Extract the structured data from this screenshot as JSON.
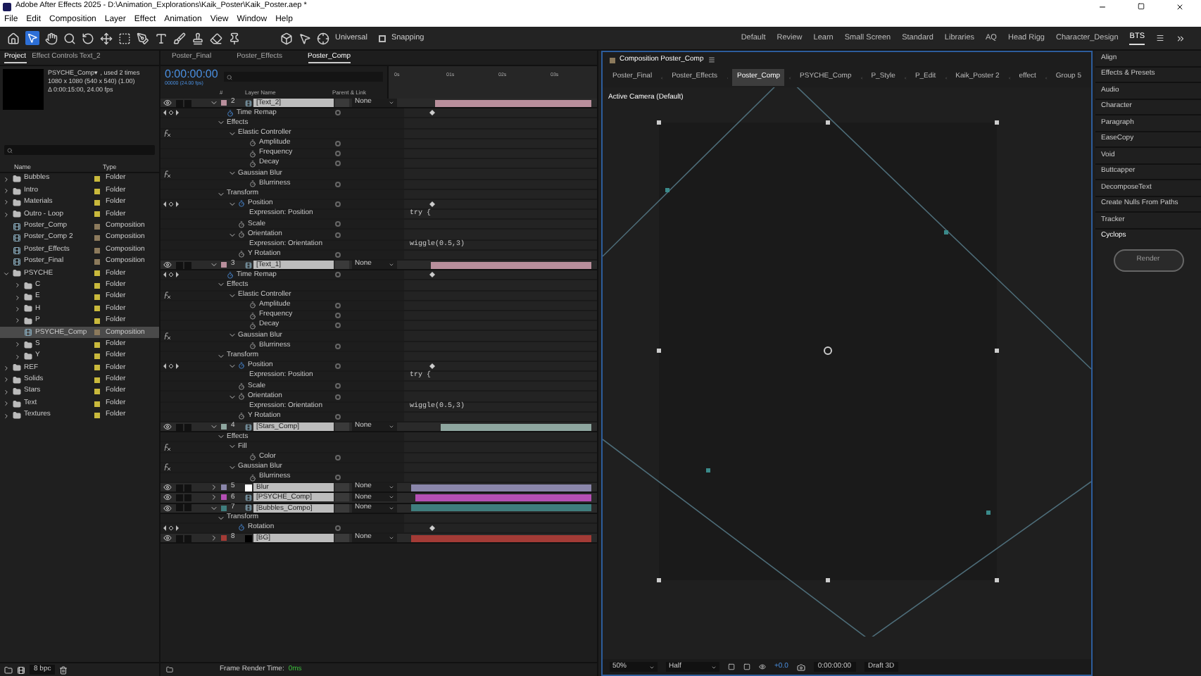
{
  "window": {
    "title": "Adobe After Effects 2025 - D:\\Animation_Explorations\\Kaik_Poster\\Kaik_Poster.aep *"
  },
  "menu": [
    "File",
    "Edit",
    "Composition",
    "Layer",
    "Effect",
    "Animation",
    "View",
    "Window",
    "Help"
  ],
  "toolbar": {
    "axis_mode": "Universal",
    "snapping": {
      "label": "Snapping",
      "checked": false
    }
  },
  "workspaces": [
    {
      "label": "Default",
      "selected": false
    },
    {
      "label": "Review",
      "selected": false
    },
    {
      "label": "Learn",
      "selected": false
    },
    {
      "label": "Small Screen",
      "selected": false
    },
    {
      "label": "Standard",
      "selected": false
    },
    {
      "label": "Libraries",
      "selected": false
    },
    {
      "label": "AQ",
      "selected": false
    },
    {
      "label": "Head Rigg",
      "selected": false
    },
    {
      "label": "Character_Design",
      "selected": false
    },
    {
      "label": "BTS",
      "selected": true
    }
  ],
  "project_panel": {
    "tabs": [
      {
        "label": "Project",
        "selected": true
      },
      {
        "label": "Effect Controls Text_2",
        "selected": false
      }
    ],
    "info": [
      "PSYCHE_Comp▾ , used 2 times",
      "1080 x 1080  (540 x 540) (1.00)",
      "Δ 0:00:15:00, 24.00 fps"
    ],
    "columns": [
      "Name",
      "Type"
    ],
    "items": [
      {
        "name": "Bubbles",
        "type": "Folder",
        "kind": "folder",
        "expanded": false,
        "selected": false,
        "color": "#c9b93c"
      },
      {
        "name": "Intro",
        "type": "Folder",
        "kind": "folder",
        "expanded": false,
        "selected": false,
        "color": "#c9b93c"
      },
      {
        "name": "Materials",
        "type": "Folder",
        "kind": "folder",
        "expanded": false,
        "selected": false,
        "color": "#c9b93c"
      },
      {
        "name": "Outro - Loop",
        "type": "Folder",
        "kind": "folder",
        "expanded": false,
        "selected": false,
        "color": "#c9b93c"
      },
      {
        "name": "Poster_Comp",
        "type": "Composition",
        "kind": "comp",
        "selected": false,
        "color": "#8c7a5c"
      },
      {
        "name": "Poster_Comp 2",
        "type": "Composition",
        "kind": "comp",
        "selected": false,
        "color": "#8c7a5c"
      },
      {
        "name": "Poster_Effects",
        "type": "Composition",
        "kind": "comp",
        "selected": false,
        "color": "#8c7a5c"
      },
      {
        "name": "Poster_Final",
        "type": "Composition",
        "kind": "comp",
        "selected": false,
        "color": "#8c7a5c"
      },
      {
        "name": "PSYCHE",
        "type": "Folder",
        "kind": "folder",
        "expanded": true,
        "selected": false,
        "color": "#c9b93c",
        "children": [
          {
            "name": "C",
            "type": "Folder",
            "kind": "folder",
            "expanded": false,
            "selected": false,
            "color": "#c9b93c"
          },
          {
            "name": "E",
            "type": "Folder",
            "kind": "folder",
            "expanded": false,
            "selected": false,
            "color": "#c9b93c"
          },
          {
            "name": "H",
            "type": "Folder",
            "kind": "folder",
            "expanded": false,
            "selected": false,
            "color": "#c9b93c"
          },
          {
            "name": "P",
            "type": "Folder",
            "kind": "folder",
            "expanded": false,
            "selected": false,
            "color": "#c9b93c"
          },
          {
            "name": "PSYCHE_Comp",
            "type": "Composition",
            "kind": "comp",
            "selected": true,
            "color": "#8c7a5c"
          },
          {
            "name": "S",
            "type": "Folder",
            "kind": "folder",
            "expanded": false,
            "selected": false,
            "color": "#c9b93c"
          },
          {
            "name": "Y",
            "type": "Folder",
            "kind": "folder",
            "expanded": false,
            "selected": false,
            "color": "#c9b93c"
          }
        ]
      },
      {
        "name": "REF",
        "type": "Folder",
        "kind": "folder",
        "expanded": false,
        "selected": false,
        "color": "#c9b93c"
      },
      {
        "name": "Solids",
        "type": "Folder",
        "kind": "folder",
        "expanded": false,
        "selected": false,
        "color": "#c9b93c"
      },
      {
        "name": "Stars",
        "type": "Folder",
        "kind": "folder",
        "expanded": false,
        "selected": false,
        "color": "#c9b93c"
      },
      {
        "name": "Text",
        "type": "Folder",
        "kind": "folder",
        "expanded": false,
        "selected": false,
        "color": "#c9b93c"
      },
      {
        "name": "Textures",
        "type": "Folder",
        "kind": "folder",
        "expanded": false,
        "selected": false,
        "color": "#c9b93c"
      }
    ],
    "bit_depth": "8 bpc"
  },
  "timeline": {
    "tabs": [
      {
        "label": "Poster_Final",
        "selected": false
      },
      {
        "label": "Poster_Effects",
        "selected": false
      },
      {
        "label": "Poster_Comp",
        "selected": true
      }
    ],
    "timecode": "0:00:00:00",
    "frame_info": "00000 (24.00 fps)",
    "columns": [
      "#",
      "Layer Name",
      "Parent & Link"
    ],
    "ruler": [
      "0s",
      "01s",
      "02s",
      "03s"
    ],
    "layers": [
      {
        "number": "2",
        "name": "[Text_2]",
        "kind": "comp",
        "solo": false,
        "locked": false,
        "color": "#b98f9c",
        "parent": "None",
        "expanded": true,
        "children": [
          {
            "name": "Time Remap",
            "kind": "property",
            "keyframed": true
          },
          {
            "name": "Effects",
            "kind": "group",
            "expanded": true,
            "children": [
              {
                "name": "Elastic Controller",
                "kind": "effect",
                "expanded": true,
                "children": [
                  {
                    "name": "Amplitude",
                    "kind": "property",
                    "keyframed": false
                  },
                  {
                    "name": "Frequency",
                    "kind": "property",
                    "keyframed": false
                  },
                  {
                    "name": "Decay",
                    "kind": "property",
                    "keyframed": false
                  }
                ]
              },
              {
                "name": "Gaussian Blur",
                "kind": "effect",
                "expanded": true,
                "children": [
                  {
                    "name": "Blurriness",
                    "kind": "property",
                    "keyframed": false
                  }
                ]
              }
            ]
          },
          {
            "name": "Transform",
            "kind": "group",
            "expanded": true,
            "children": [
              {
                "name": "Position",
                "kind": "property",
                "keyframed": true,
                "expanded": true,
                "children": [
                  {
                    "name": "Expression: Position",
                    "kind": "expression",
                    "code": "try {"
                  }
                ]
              },
              {
                "name": "Scale",
                "kind": "property",
                "keyframed": false
              },
              {
                "name": "Orientation",
                "kind": "property",
                "keyframed": false,
                "expanded": true,
                "children": [
                  {
                    "name": "Expression: Orientation",
                    "kind": "expression",
                    "code": "wiggle(0.5,3)"
                  }
                ]
              },
              {
                "name": "Y Rotation",
                "kind": "property",
                "keyframed": false
              }
            ]
          }
        ]
      },
      {
        "number": "3",
        "name": "[Text_1]",
        "kind": "comp",
        "solo": false,
        "locked": false,
        "color": "#b98f9c",
        "parent": "None",
        "expanded": true,
        "children": [
          {
            "name": "Time Remap",
            "kind": "property",
            "keyframed": true
          },
          {
            "name": "Effects",
            "kind": "group",
            "expanded": true,
            "children": [
              {
                "name": "Elastic Controller",
                "kind": "effect",
                "expanded": true,
                "children": [
                  {
                    "name": "Amplitude",
                    "kind": "property",
                    "keyframed": false
                  },
                  {
                    "name": "Frequency",
                    "kind": "property",
                    "keyframed": false
                  },
                  {
                    "name": "Decay",
                    "kind": "property",
                    "keyframed": false
                  }
                ]
              },
              {
                "name": "Gaussian Blur",
                "kind": "effect",
                "expanded": true,
                "children": [
                  {
                    "name": "Blurriness",
                    "kind": "property",
                    "keyframed": false
                  }
                ]
              }
            ]
          },
          {
            "name": "Transform",
            "kind": "group",
            "expanded": true,
            "children": [
              {
                "name": "Position",
                "kind": "property",
                "keyframed": true,
                "expanded": true,
                "children": [
                  {
                    "name": "Expression: Position",
                    "kind": "expression",
                    "code": "try {"
                  }
                ]
              },
              {
                "name": "Scale",
                "kind": "property",
                "keyframed": false
              },
              {
                "name": "Orientation",
                "kind": "property",
                "keyframed": false,
                "expanded": true,
                "children": [
                  {
                    "name": "Expression: Orientation",
                    "kind": "expression",
                    "code": "wiggle(0.5,3)"
                  }
                ]
              },
              {
                "name": "Y Rotation",
                "kind": "property",
                "keyframed": false
              }
            ]
          }
        ]
      },
      {
        "number": "4",
        "name": "[Stars_Comp]",
        "kind": "comp",
        "solo": false,
        "locked": false,
        "color": "#8ea69f",
        "parent": "None",
        "expanded": true,
        "children": [
          {
            "name": "Effects",
            "kind": "group",
            "expanded": true,
            "children": [
              {
                "name": "Fill",
                "kind": "effect",
                "expanded": true,
                "children": [
                  {
                    "name": "Color",
                    "kind": "property",
                    "keyframed": false
                  }
                ]
              },
              {
                "name": "Gaussian Blur",
                "kind": "effect",
                "expanded": true,
                "children": [
                  {
                    "name": "Blurriness",
                    "kind": "property",
                    "keyframed": false
                  }
                ]
              }
            ]
          }
        ]
      },
      {
        "number": "5",
        "name": "Blur",
        "kind": "solid",
        "solo": false,
        "locked": false,
        "color": "#8a86aa",
        "parent": "None",
        "expanded": false
      },
      {
        "number": "6",
        "name": "[PSYCHE_Comp]",
        "kind": "comp",
        "solo": false,
        "locked": false,
        "color": "#b54fb4",
        "parent": "None",
        "expanded": false
      },
      {
        "number": "7",
        "name": "[Bubbles_Compo]",
        "kind": "comp",
        "solo": false,
        "locked": false,
        "color": "#3f7d7d",
        "parent": "None",
        "expanded": true,
        "children": [
          {
            "name": "Transform",
            "kind": "group",
            "expanded": true,
            "children": [
              {
                "name": "Rotation",
                "kind": "property",
                "keyframed": true
              }
            ]
          }
        ]
      },
      {
        "number": "8",
        "name": "[BG]",
        "kind": "solid-black",
        "solo": false,
        "locked": false,
        "color": "#a33b36",
        "parent": "None",
        "expanded": false
      }
    ],
    "render_time_label": "Frame Render Time:",
    "render_time": "0ms"
  },
  "composition": {
    "title": "Composition Poster_Comp",
    "breadcrumbs": [
      {
        "label": "Poster_Final",
        "selected": false
      },
      {
        "label": "Poster_Effects",
        "selected": false
      },
      {
        "label": "Poster_Comp",
        "selected": true
      },
      {
        "label": "PSYCHE_Comp",
        "selected": false
      },
      {
        "label": "P_Style",
        "selected": false
      },
      {
        "label": "P_Edit",
        "selected": false
      },
      {
        "label": "Kaik_Poster 2",
        "selected": false
      },
      {
        "label": "effect",
        "selected": false
      },
      {
        "label": "Group 5",
        "selected": false
      }
    ],
    "camera": "Active Camera (Default)",
    "zoom": "50%",
    "resolution": "Half",
    "exposure": "+0.0",
    "timecode": "0:00:00:00",
    "renderer": "Draft 3D"
  },
  "right_panel": {
    "items": [
      "Align",
      "Effects & Presets",
      "Audio",
      "Character",
      "Paragraph",
      "EaseCopy",
      "Void",
      "Buttcapper",
      "DecomposeText",
      "Create Nulls From Paths",
      "Tracker"
    ],
    "cyclops": {
      "title": "Cyclops",
      "button": "Render"
    }
  }
}
